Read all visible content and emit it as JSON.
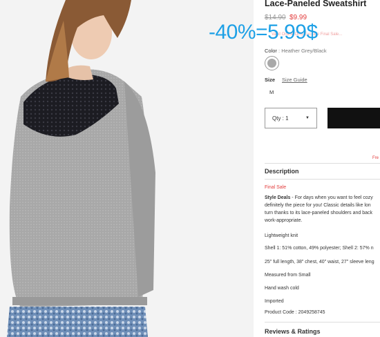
{
  "product": {
    "title": "Lace-Paneled Sweatshirt",
    "price_old": "$14.90",
    "price_new": "$9.99",
    "promo_text": "Valid Online Only Exclude Final Sale...",
    "overlay_text": "-40%=5.99$",
    "color_label": "Color",
    "color_value": ": Heather Grey/Black",
    "size_label": "Size",
    "size_guide": "Size Guide",
    "size_option": "M",
    "qty_label": "Qty : 1",
    "qty_caret": "▼",
    "free_ship": "Fre"
  },
  "description": {
    "heading": "Description",
    "final_sale": "Final Sale",
    "style_deals_label": "Style Deals",
    "body_lines": [
      " - For days when you want to feel cozy",
      "definitely the piece for you! Classic details like lon",
      "turn thanks to its lace-paneled shoulders and back",
      "work-appropriate."
    ],
    "details": [
      "Lightweight knit",
      "Shell 1: 51% cotton, 49% polyester; Shell 2: 57% n",
      "25\" full length, 38\" chest, 40\" waist, 27\" sleeve leng",
      "Measured from Small",
      "Hand wash cold",
      "Imported",
      "Product Code : 2049258745"
    ]
  },
  "reviews": {
    "heading": "Reviews & Ratings"
  },
  "colors": {
    "overlay": "#1da0e6",
    "sale": "#e23b3b",
    "sweater": "#a8a8a8",
    "lace": "#1c1c22",
    "hair": "#8a5a35"
  }
}
